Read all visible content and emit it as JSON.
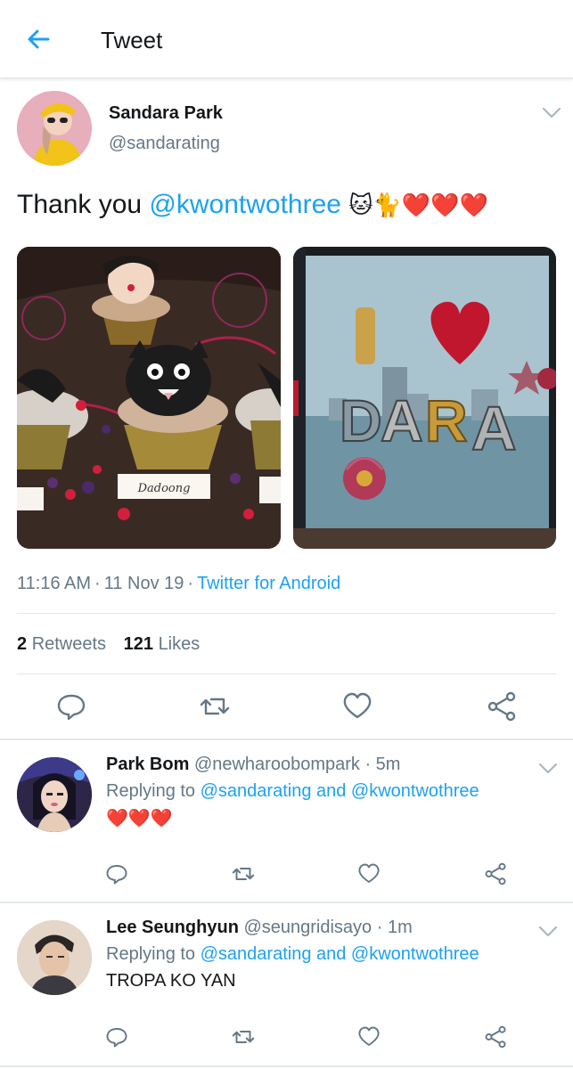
{
  "header": {
    "title": "Tweet"
  },
  "tweet": {
    "author_name": "Sandara Park",
    "author_handle": "@sandarating",
    "text_prefix": "Thank you ",
    "mention": "@kwontwothree",
    "emojis": "🐱🐈❤️❤️❤️",
    "photos": [
      {
        "label": "Dadoong"
      },
      {
        "label": "I ♥ DARA"
      }
    ],
    "time": "11:16 AM",
    "date": "11 Nov 19",
    "source": "Twitter for Android",
    "retweets_count": "2",
    "retweets_label": "Retweets",
    "likes_count": "121",
    "likes_label": "Likes"
  },
  "replies": [
    {
      "name": "Park Bom",
      "handle": "@newharoobompark",
      "time": "· 5m",
      "replying_prefix": "Replying to",
      "replying_to": "@sandarating and @kwontwothree",
      "text": "❤️❤️❤️"
    },
    {
      "name": "Lee Seunghyun",
      "handle": "@seungridisayo",
      "time": "· 1m",
      "replying_prefix": "Replying to",
      "replying_to": "@sandarating and @kwontwothree",
      "text": "TROPA KO YAN"
    }
  ],
  "colors": {
    "accent": "#1da1f2",
    "secondary_text": "#657786",
    "heart": "#e0245e"
  },
  "icons": [
    "back-arrow-icon",
    "chevron-down-icon",
    "reply-icon",
    "retweet-icon",
    "like-icon",
    "share-icon"
  ]
}
